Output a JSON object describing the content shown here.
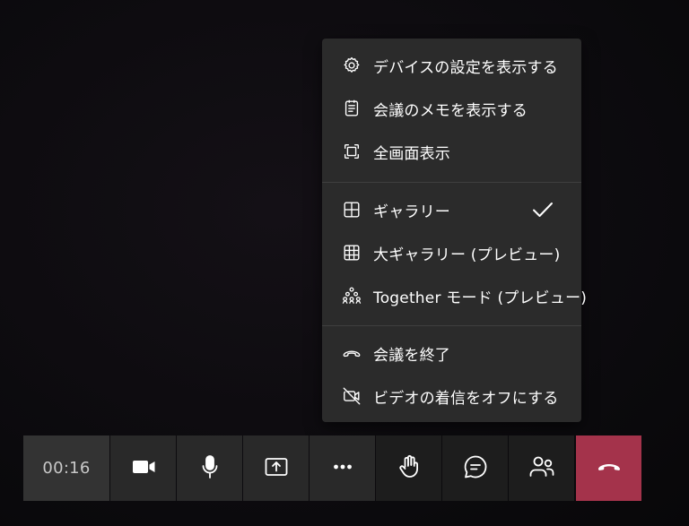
{
  "menu": {
    "items": [
      {
        "label": "デバイスの設定を表示する",
        "icon": "gear-icon"
      },
      {
        "label": "会議のメモを表示する",
        "icon": "notes-icon"
      },
      {
        "label": "全画面表示",
        "icon": "fullscreen-icon"
      },
      {
        "label": "ギャラリー",
        "icon": "grid-2x2-icon",
        "checked": true
      },
      {
        "label": "大ギャラリー (プレビュー)",
        "icon": "grid-3x3-icon"
      },
      {
        "label": "Together モード (プレビュー)",
        "icon": "together-mode-icon"
      },
      {
        "label": "会議を終了",
        "icon": "end-meeting-icon"
      },
      {
        "label": "ビデオの着信をオフにする",
        "icon": "video-off-icon"
      }
    ]
  },
  "toolbar": {
    "timer": "00:16",
    "buttons": [
      {
        "name": "camera",
        "icon": "video-camera-icon"
      },
      {
        "name": "microphone",
        "icon": "microphone-icon"
      },
      {
        "name": "share",
        "icon": "share-screen-icon"
      },
      {
        "name": "more",
        "icon": "more-icon"
      },
      {
        "name": "raise-hand",
        "icon": "raise-hand-icon"
      },
      {
        "name": "chat",
        "icon": "chat-icon"
      },
      {
        "name": "participants",
        "icon": "participants-icon"
      },
      {
        "name": "hang-up",
        "icon": "hang-up-icon"
      }
    ]
  },
  "colors": {
    "menu_bg": "#2b2b2b",
    "toolbar_bg": "#292929",
    "hang_up": "#a4334b",
    "text": "#ffffff"
  }
}
